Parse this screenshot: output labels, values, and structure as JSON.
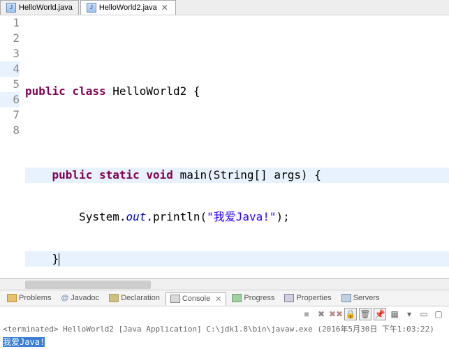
{
  "editorTabs": [
    {
      "label": "HelloWorld.java",
      "active": false
    },
    {
      "label": "HelloWorld2.java",
      "active": true
    }
  ],
  "code": {
    "lineCount": 8,
    "lines": {
      "1": "",
      "2_kw1": "public",
      "2_kw2": "class",
      "2_name": " HelloWorld2 {",
      "3": "",
      "4_indent": "    ",
      "4_kw1": "public",
      "4_kw2": "static",
      "4_kw3": "void",
      "4_rest": " main(String[] args) {",
      "5_indent": "        ",
      "5_before": "System.",
      "5_out": "out",
      "5_mid": ".println(",
      "5_str": "\"我爱Java!\"",
      "5_after": ");",
      "6_indent": "    ",
      "6_brace": "}",
      "7": "}",
      "8": ""
    }
  },
  "bottomTabs": {
    "problems": "Problems",
    "javadoc": "Javadoc",
    "declaration": "Declaration",
    "console": "Console",
    "progress": "Progress",
    "properties": "Properties",
    "servers": "Servers"
  },
  "consoleView": {
    "header": "<terminated> HelloWorld2 [Java Application] C:\\jdk1.8\\bin\\javaw.exe (2016年5月30日 下午1:03:22)",
    "output": "我爱Java!"
  }
}
